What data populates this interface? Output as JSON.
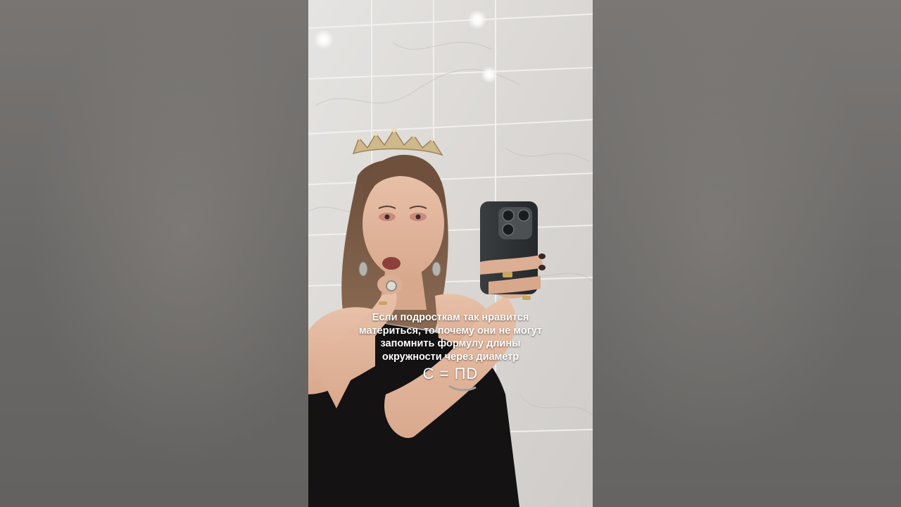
{
  "caption": {
    "lines": [
      "Если подросткам так нравится",
      "материться, то почему они не могут",
      "запомнить формулу длины",
      "окружности через диаметр"
    ],
    "formula": "C = ПD"
  },
  "colors": {
    "background": "#6e6c6a",
    "caption_text": "#ffffff",
    "wall_tile": "#dcd9d6",
    "dress": "#141212",
    "phone": "#2e3133"
  }
}
